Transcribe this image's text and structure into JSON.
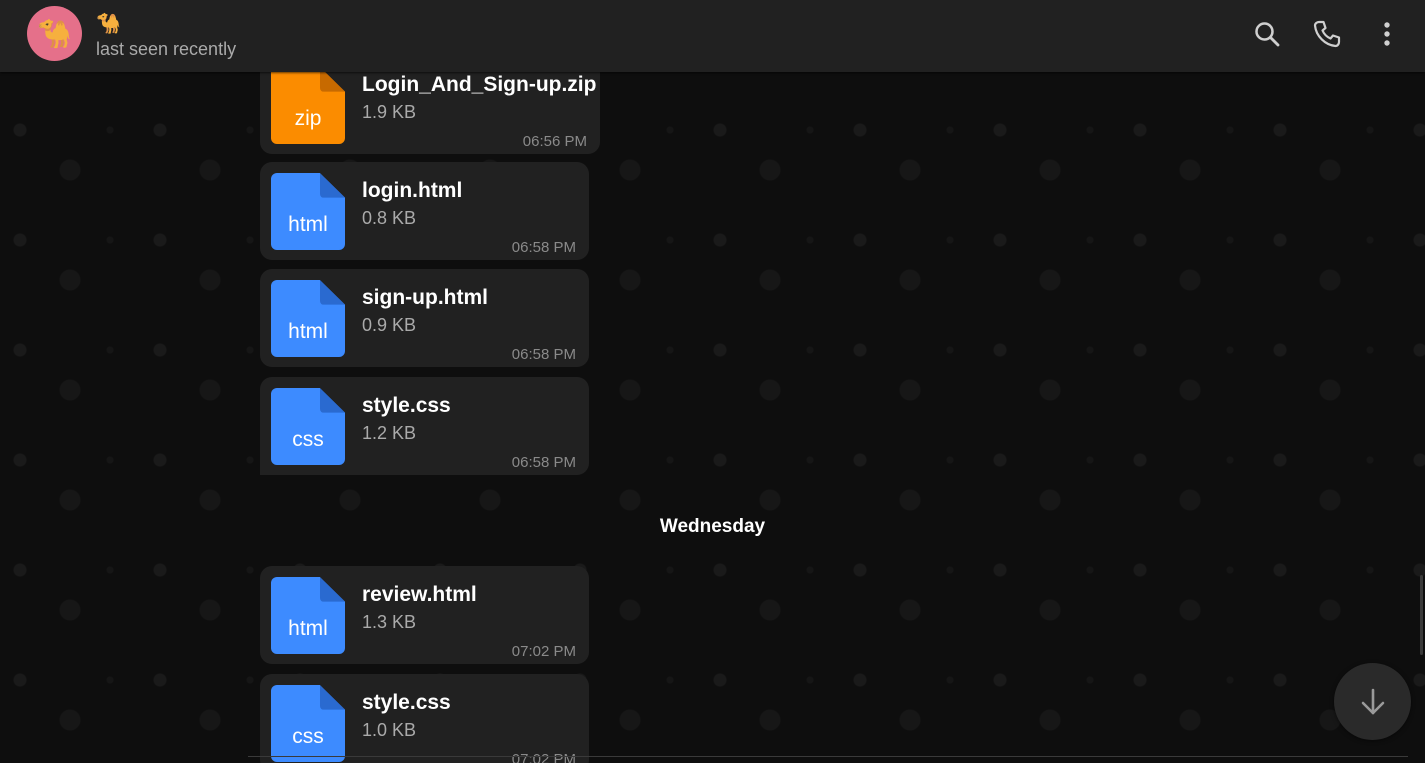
{
  "header": {
    "avatar_emoji": "🐪",
    "chat_name": "🐪",
    "status": "last seen recently",
    "icons": [
      "search-icon",
      "phone-icon",
      "more-vertical-icon"
    ]
  },
  "colors": {
    "zip": "#fb8c00",
    "html": "#3d8bff",
    "css": "#3d8bff",
    "bubble": "#212121",
    "header": "#212121"
  },
  "messages": [
    {
      "ext": "zip",
      "name": "Login_And_Sign-up.zip",
      "size": "1.9 KB",
      "time": "06:56 PM"
    },
    {
      "ext": "html",
      "name": "login.html",
      "size": "0.8 KB",
      "time": "06:58 PM"
    },
    {
      "ext": "html",
      "name": "sign-up.html",
      "size": "0.9 KB",
      "time": "06:58 PM"
    },
    {
      "ext": "css",
      "name": "style.css",
      "size": "1.2 KB",
      "time": "06:58 PM"
    },
    {
      "ext": "html",
      "name": "review.html",
      "size": "1.3 KB",
      "time": "07:02 PM"
    },
    {
      "ext": "css",
      "name": "style.css",
      "size": "1.0 KB",
      "time": "07:02 PM"
    }
  ],
  "date_separator": "Wednesday",
  "scroll_down_icon": "arrow-down-icon"
}
